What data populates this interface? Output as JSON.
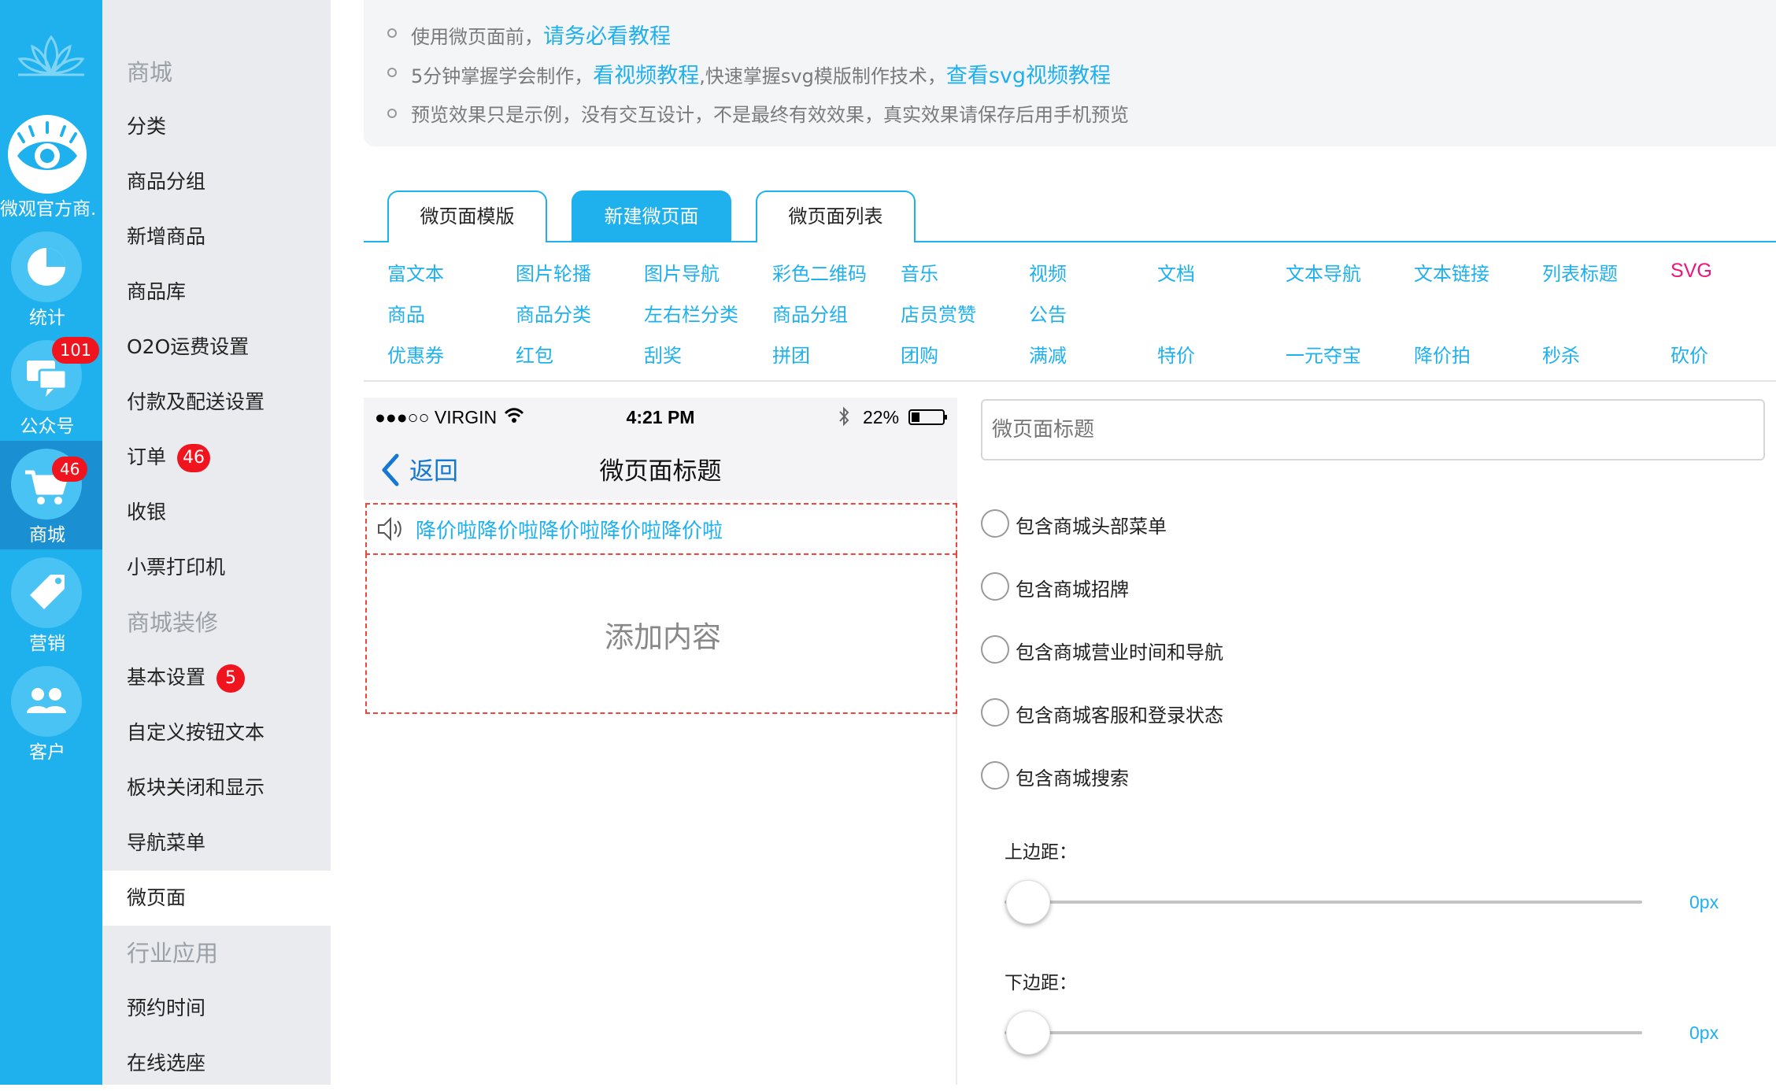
{
  "rail": {
    "items": [
      {
        "label": "微观官方商..."
      },
      {
        "label": "统计"
      },
      {
        "label": "公众号",
        "badge": "101"
      },
      {
        "label": "商城",
        "badge": "46"
      },
      {
        "label": "营销"
      },
      {
        "label": "客户"
      }
    ]
  },
  "menu": {
    "items": [
      {
        "label": "商城",
        "type": "header"
      },
      {
        "label": "分类"
      },
      {
        "label": "商品分组"
      },
      {
        "label": "新增商品"
      },
      {
        "label": "商品库"
      },
      {
        "label": "O2O运费设置"
      },
      {
        "label": "付款及配送设置"
      },
      {
        "label": "订单",
        "badge": "46"
      },
      {
        "label": "收银"
      },
      {
        "label": "小票打印机"
      },
      {
        "label": "商城装修",
        "type": "header"
      },
      {
        "label": "基本设置",
        "badge": "5"
      },
      {
        "label": "自定义按钮文本"
      },
      {
        "label": "板块关闭和显示"
      },
      {
        "label": "导航菜单"
      },
      {
        "label": "微页面",
        "active": true
      },
      {
        "label": "行业应用",
        "type": "header"
      },
      {
        "label": "预约时间"
      },
      {
        "label": "在线选座"
      }
    ]
  },
  "notice": {
    "line1_text": "使用微页面前，",
    "line1_link": "请务必看教程",
    "line2_text1": "5分钟掌握学会制作，",
    "line2_link1": "看视频教程",
    "line2_text2": ",快速掌握svg模版制作技术，",
    "line2_link2": "查看svg视频教程",
    "line3_text": "预览效果只是示例，没有交互设计，不是最终有效效果，真实效果请保存后用手机预览"
  },
  "tabs": [
    {
      "label": "微页面模版"
    },
    {
      "label": "新建微页面",
      "active": true
    },
    {
      "label": "微页面列表"
    }
  ],
  "components": {
    "row1": [
      "富文本",
      "图片轮播",
      "图片导航",
      "彩色二维码",
      "音乐",
      "视频",
      "文档",
      "文本导航",
      "文本链接",
      "列表标题",
      "SVG"
    ],
    "row2": [
      "商品",
      "商品分类",
      "左右栏分类",
      "商品分组",
      "店员赏赞",
      "公告"
    ],
    "row3": [
      "优惠券",
      "红包",
      "刮奖",
      "拼团",
      "团购",
      "满减",
      "特价",
      "一元夺宝",
      "降价拍",
      "秒杀",
      "砍价"
    ]
  },
  "phone": {
    "carrier": "●●●○○ VIRGIN",
    "time": "4:21 PM",
    "battery": "22%",
    "back_label": "返回",
    "title": "微页面标题",
    "ticker_text": "降价啦降价啦降价啦降价啦降价啦",
    "add_content": "添加内容"
  },
  "settings": {
    "title_placeholder": "微页面标题",
    "options": [
      {
        "label": "包含商城头部菜单"
      },
      {
        "label": "包含商城招牌"
      },
      {
        "label": "包含商城营业时间和导航"
      },
      {
        "label": "包含商城客服和登录状态"
      },
      {
        "label": "包含商城搜索"
      }
    ],
    "top_margin_label": "上边距：",
    "top_margin_value": "0px",
    "bottom_margin_label": "下边距：",
    "bottom_margin_value": "0px"
  },
  "colors": {
    "accent": "#1fb0ee",
    "rail": "#1fb0ee",
    "badge": "#f0141e",
    "svg_link": "#f0147a",
    "dashed_border": "#f0453a"
  }
}
